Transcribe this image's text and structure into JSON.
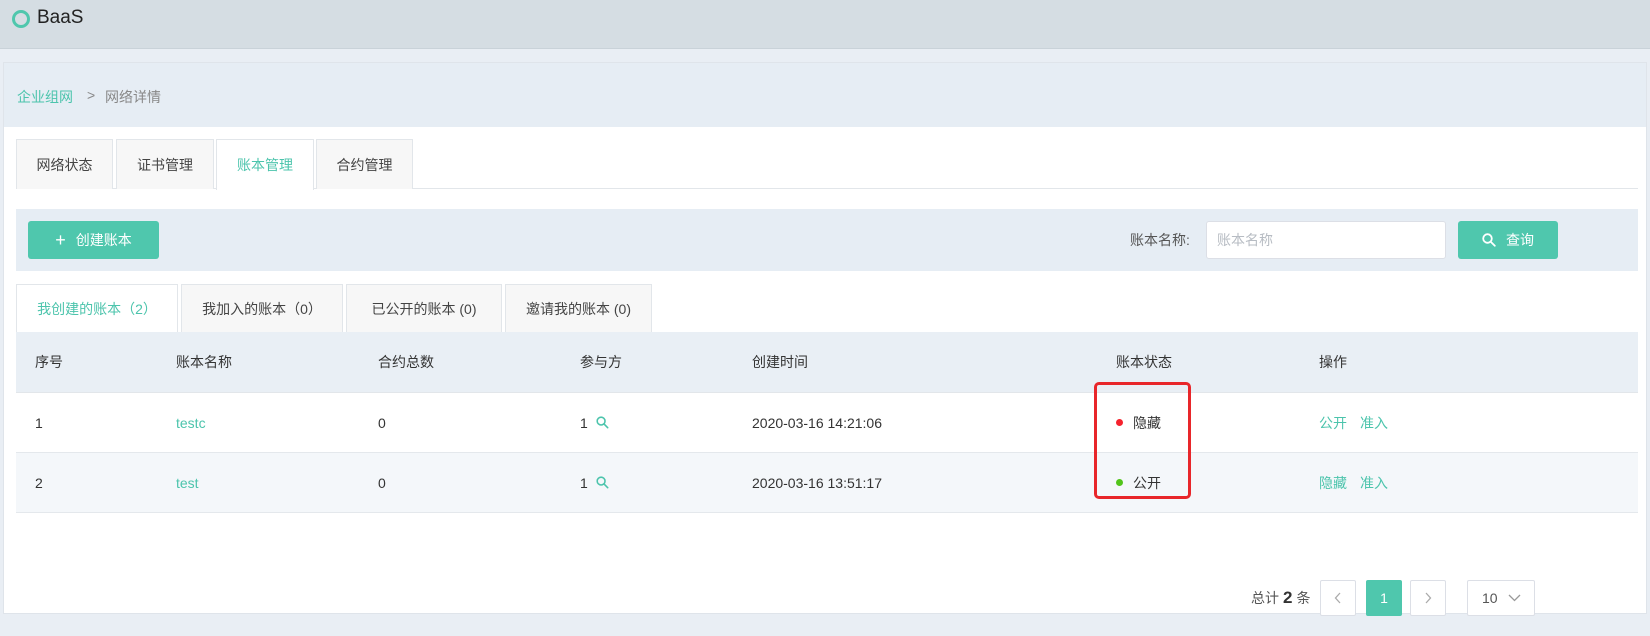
{
  "app": {
    "title": "BaaS"
  },
  "breadcrumb": {
    "parent": "企业组网",
    "separator": ">",
    "current": "网络详情"
  },
  "tabs": [
    {
      "label": "网络状态"
    },
    {
      "label": "证书管理"
    },
    {
      "label": "账本管理"
    },
    {
      "label": "合约管理"
    }
  ],
  "toolbar": {
    "create_label": "创建账本",
    "search_label": "账本名称:",
    "search_placeholder": "账本名称",
    "query_label": "查询"
  },
  "subtabs": [
    {
      "label": "我创建的账本（2）"
    },
    {
      "label": "我加入的账本（0）"
    },
    {
      "label": "已公开的账本 (0)"
    },
    {
      "label": "邀请我的账本 (0)"
    }
  ],
  "table": {
    "headers": [
      "序号",
      "账本名称",
      "合约总数",
      "参与方",
      "创建时间",
      "账本状态",
      "操作"
    ],
    "rows": [
      {
        "index": "1",
        "name": "testc",
        "contracts": "0",
        "participants": "1",
        "created": "2020-03-16 14:21:06",
        "status": "隐藏",
        "status_color": "#f5222d",
        "action1": "公开",
        "action2": "准入"
      },
      {
        "index": "2",
        "name": "test",
        "contracts": "0",
        "participants": "1",
        "created": "2020-03-16 13:51:17",
        "status": "公开",
        "status_color": "#52c41a",
        "action1": "隐藏",
        "action2": "准入"
      }
    ]
  },
  "pagination": {
    "total_prefix": "总计",
    "total": "2",
    "total_suffix": "条",
    "current_page": "1",
    "page_size": "10"
  },
  "colors": {
    "accent": "#4fc7ad",
    "highlight": "#e8262a"
  }
}
